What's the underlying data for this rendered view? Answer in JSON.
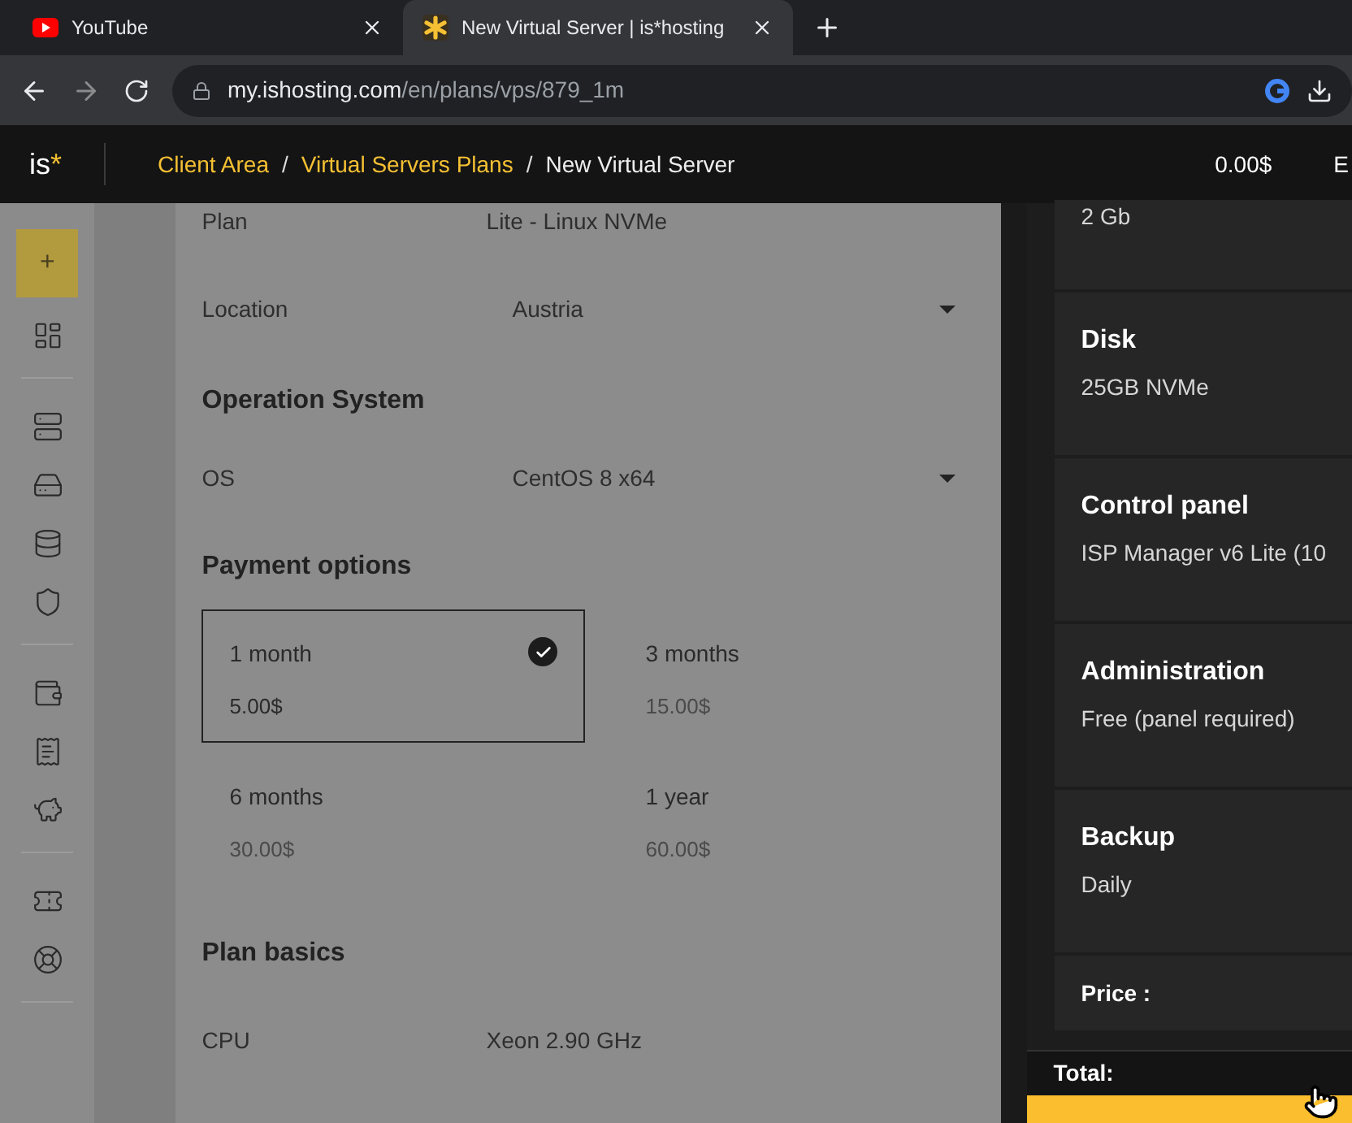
{
  "browser": {
    "tabs": [
      {
        "title": "YouTube",
        "selected": false
      },
      {
        "title": "New Virtual Server | is*hosting",
        "selected": true
      }
    ],
    "url_host": "my.ishosting.com",
    "url_path": "/en/plans/vps/879_1m"
  },
  "header": {
    "logo": "is",
    "logo_mark": "*",
    "breadcrumbs": [
      {
        "label": "Client Area",
        "link": true
      },
      {
        "label": "Virtual Servers Plans",
        "link": true
      },
      {
        "label": "New Virtual Server",
        "link": false
      }
    ],
    "separator": "/",
    "balance": "0.00$",
    "cut_item": "E"
  },
  "sidebar": {
    "add": "+"
  },
  "form": {
    "rows_top": [
      {
        "label": "Plan",
        "value": "Lite - Linux NVMe",
        "dropdown": false
      },
      {
        "label": "Location",
        "value": "Austria",
        "dropdown": true
      }
    ],
    "os_heading": "Operation System",
    "os_rows": [
      {
        "label": "OS",
        "value": "CentOS 8 x64",
        "dropdown": true
      }
    ],
    "payment_heading": "Payment options",
    "payment_options": [
      {
        "period": "1 month",
        "price": "5.00$",
        "selected": true
      },
      {
        "period": "3 months",
        "price": "15.00$",
        "selected": false
      },
      {
        "period": "6 months",
        "price": "30.00$",
        "selected": false
      },
      {
        "period": "1 year",
        "price": "60.00$",
        "selected": false
      }
    ],
    "basics_heading": "Plan basics",
    "basics_rows": [
      {
        "label": "CPU",
        "value": "Xeon 2.90 GHz",
        "dropdown": false
      }
    ]
  },
  "summary": {
    "cards": [
      {
        "value": "2 Gb"
      },
      {
        "title": "Disk",
        "value": "25GB NVMe"
      },
      {
        "title": "Control panel",
        "value": "ISP Manager v6 Lite (10"
      },
      {
        "title": "Administration",
        "value": "Free (panel required)"
      },
      {
        "title": "Backup",
        "value": "Daily"
      }
    ],
    "price_label": "Price :",
    "total_label": "Total:"
  }
}
